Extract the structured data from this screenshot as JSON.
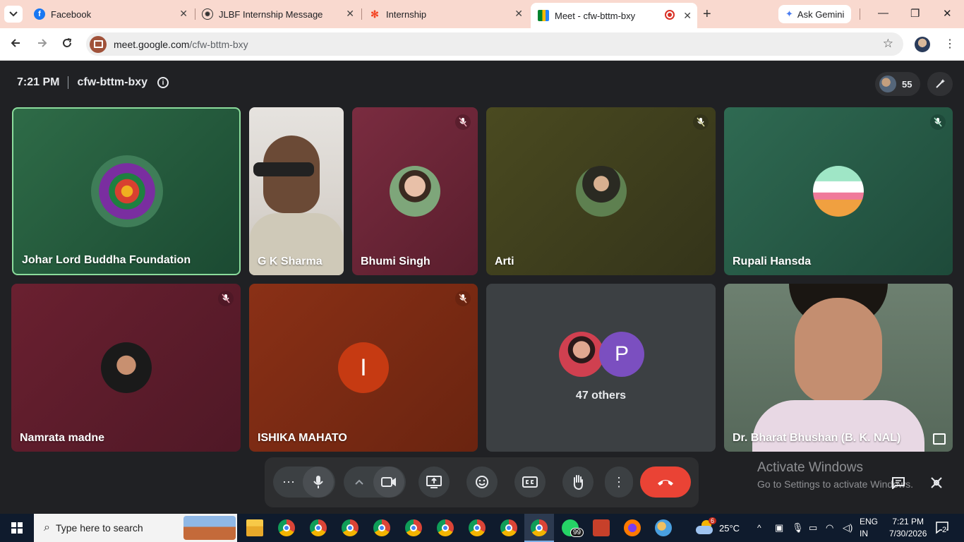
{
  "browser": {
    "tabs": [
      {
        "title": "Facebook",
        "icon": "facebook-icon"
      },
      {
        "title": "JLBF Internship Message",
        "icon": "chatgpt-icon"
      },
      {
        "title": "Internship",
        "icon": "joomla-icon"
      },
      {
        "title": "Meet - cfw-bttm-bxy",
        "icon": "meet-icon",
        "active": true,
        "recording": true
      }
    ],
    "ask_gemini": "Ask Gemini",
    "url_domain": "meet.google.com",
    "url_path": "/cfw-bttm-bxy"
  },
  "meet": {
    "time": "7:21 PM",
    "meeting_code": "cfw-bttm-bxy",
    "participant_count": "55",
    "tiles": [
      {
        "name": "Johar Lord Buddha Foundation",
        "muted": false,
        "speaking": true
      },
      {
        "name": "G K Sharma",
        "muted": false,
        "video": true
      },
      {
        "name": "Bhumi Singh",
        "muted": true
      },
      {
        "name": "Arti",
        "muted": true
      },
      {
        "name": "Rupali Hansda",
        "muted": true
      },
      {
        "name": "Namrata madne",
        "muted": true
      },
      {
        "name": "ISHIKA MAHATO",
        "muted": true,
        "initial": "I"
      },
      {
        "name": "47 others",
        "initial": "P"
      },
      {
        "name": "Dr. Bharat Bhushan (B. K. NAL)",
        "video": true
      }
    ],
    "watermark_line1": "Activate Windows",
    "watermark_line2": "Go to Settings to activate Windows."
  },
  "taskbar": {
    "search_placeholder": "Type here to search",
    "whatsapp_badge": "99",
    "weather_badge": "6",
    "temperature": "25°C",
    "lang_line1": "ENG",
    "lang_line2": "IN",
    "clock_time": "7:21 PM",
    "clock_date": "7/30/2026",
    "notification_count": "2"
  },
  "colors": {
    "meet_bg": "#202124",
    "speaking_border": "#8bdc9c",
    "end_call": "#ea4335",
    "tab_strip": "#f9d9cf"
  }
}
